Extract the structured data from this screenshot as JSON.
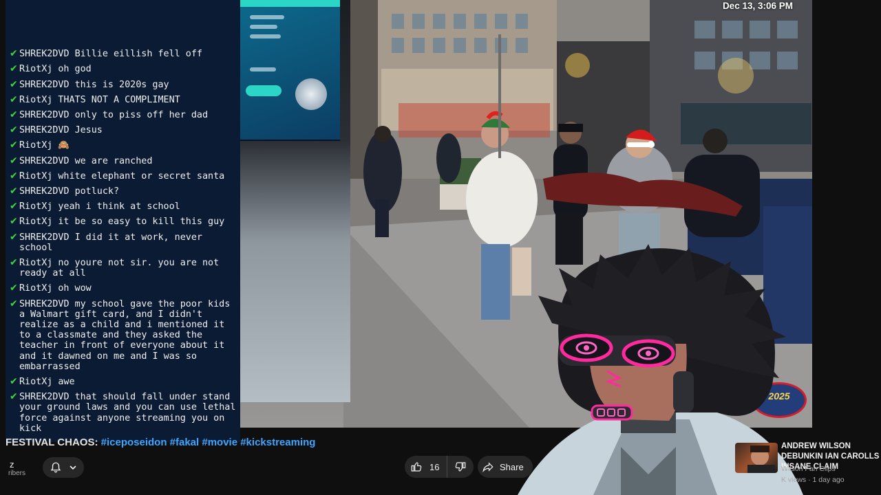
{
  "chat": {
    "messages": [
      {
        "user": "SHREK2DVD",
        "text": "Billie eillish fell off"
      },
      {
        "user": "RiotXj",
        "text": "oh god"
      },
      {
        "user": "SHREK2DVD",
        "text": "this is 2020s gay"
      },
      {
        "user": "RiotXj",
        "text": "THATS NOT A COMPLIMENT"
      },
      {
        "user": "SHREK2DVD",
        "text": "only to piss off her dad"
      },
      {
        "user": "SHREK2DVD",
        "text": "Jesus"
      },
      {
        "user": "RiotXj",
        "text": "🙈"
      },
      {
        "user": "SHREK2DVD",
        "text": "we are ranched"
      },
      {
        "user": "RiotXj",
        "text": "white elephant or secret santa"
      },
      {
        "user": "SHREK2DVD",
        "text": "potluck?"
      },
      {
        "user": "RiotXj",
        "text": "yeah i think at school"
      },
      {
        "user": "RiotXj",
        "text": "it be so easy to kill this guy"
      },
      {
        "user": "SHREK2DVD",
        "text": "I did it at work, never school"
      },
      {
        "user": "RiotXj",
        "text": "no youre not sir. you are not ready at all"
      },
      {
        "user": "RiotXj",
        "text": "oh wow"
      },
      {
        "user": "SHREK2DVD",
        "text": "my school gave the poor kids a Walmart gift card, and I didn't realize as a child and i mentioned it to a classmate and they asked the teacher in front of everyone about it and it dawned on me and I was so embarrassed"
      },
      {
        "user": "RiotXj",
        "text": "awe"
      },
      {
        "user": "SHREK2DVD",
        "text": "that should fall under stand your ground laws and you can use lethal force against anyone streaming you on kick"
      }
    ]
  },
  "video": {
    "timestamp": "Dec 13, 3:06 PM",
    "badge_text": "2025"
  },
  "below_video": {
    "title_plain": "FESTIVAL CHAOS: ",
    "title_tags": "#iceposeidon #fakal #movie #kickstreaming",
    "channel_initial": "z",
    "subs_fragment": "ribers",
    "like_count": "16",
    "share_label": "Share"
  },
  "recommendation": {
    "title": "ANDREW WILSON DEBUNKIN IAN CAROLLS INSANE CLAIM",
    "channel": "Wilson Fan Clips",
    "meta": "K views · 1 day ago"
  },
  "colors": {
    "chat_bg": "#0b1b33",
    "check_green": "#3fd63f",
    "hashtag_blue": "#3ea6ff",
    "pill_bg": "#272727"
  }
}
